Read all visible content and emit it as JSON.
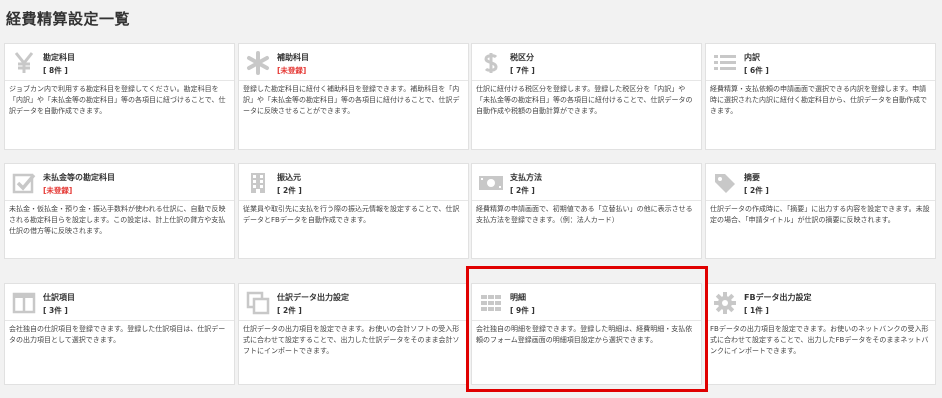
{
  "page": {
    "title": "経費精算設定一覧"
  },
  "cards": [
    {
      "title": "勘定科目",
      "count": "[ 8件 ]",
      "count_style": "normal",
      "icon": "yen-icon",
      "description": "ジョブカン内で利用する勘定科目を登録してください。勘定科目を「内訳」や「未払金等の勘定科目」等の各項目に紐づけることで、仕訳データを自動作成できます。"
    },
    {
      "title": "補助科目",
      "count": "[未登録]",
      "count_style": "warn",
      "icon": "asterisk-icon",
      "description": "登録した勘定科目に紐付く補助科目を登録できます。補助科目を「内訳」や「未払金等の勘定科目」等の各項目に紐付けることで、仕訳データに反映させることができます。"
    },
    {
      "title": "税区分",
      "count": "[ 7件 ]",
      "count_style": "normal",
      "icon": "dollar-icon",
      "description": "仕訳に紐付ける税区分を登録します。登録した税区分を「内訳」や「未払金等の勘定科目」等の各項目に紐付けることで、仕訳データの自動作成や税額の自動計算ができます。"
    },
    {
      "title": "内訳",
      "count": "[ 6件 ]",
      "count_style": "normal",
      "icon": "list-icon",
      "description": "経費精算・支払依頼の申請画面で選択できる内訳を登録します。申請時に選択された内訳に紐付く勘定科目から、仕訳データを自動作成できます。"
    },
    {
      "title": "未払金等の勘定科目",
      "count": "[未登録]",
      "count_style": "warn",
      "icon": "checkbox-icon",
      "description": "未払金・仮払金・預り金・振込手数料が使われる仕訳に、自動で反映される勘定科目らを設定します。この設定は、計上仕訳の貸方や支払仕訳の借方等に反映されます。"
    },
    {
      "title": "振込元",
      "count": "[ 2件 ]",
      "count_style": "normal",
      "icon": "building-icon",
      "description": "従業員や取引先に支払を行う際の振込元情報を設定することで、仕訳データとFBデータを自動作成できます。"
    },
    {
      "title": "支払方法",
      "count": "[ 2件 ]",
      "count_style": "normal",
      "icon": "money-icon",
      "description": "経費精算の申請画面で、初期値である「立替払い」の他に表示させる支払方法を登録できます。（例：法人カード）"
    },
    {
      "title": "摘要",
      "count": "[ 2件 ]",
      "count_style": "normal",
      "icon": "tag-icon",
      "description": "仕訳データの作成時に、「摘要」に出力する内容を設定できます。未設定の場合、「申請タイトル」が仕訳の摘要に反映されます。"
    },
    {
      "title": "仕訳項目",
      "count": "[ 3件 ]",
      "count_style": "normal",
      "icon": "columns-icon",
      "description": "会社独自の仕訳項目を登録できます。登録した仕訳項目は、仕訳データの出力項目として選択できます。"
    },
    {
      "title": "仕訳データ出力設定",
      "count": "[ 2件 ]",
      "count_style": "normal",
      "icon": "copy-icon",
      "description": "仕訳データの出力項目を設定できます。お使いの会計ソフトの受入形式に合わせて設定することで、出力した仕訳データをそのまま会計ソフトにインポートできます。"
    },
    {
      "title": "明細",
      "count": "[ 9件 ]",
      "count_style": "normal",
      "icon": "table-icon",
      "description": "会社独自の明細を登録できます。登録した明細は、経費明細・支払依頼のフォーム登録画面の明細項目設定から選択できます。"
    },
    {
      "title": "FBデータ出力設定",
      "count": "[ 1件 ]",
      "count_style": "normal",
      "icon": "gear-icon",
      "description": "FBデータの出力項目を設定できます。お使いのネットバンクの受入形式に合わせて設定することで、出力したFBデータをそのままネットバンクにインポートできます。"
    }
  ]
}
